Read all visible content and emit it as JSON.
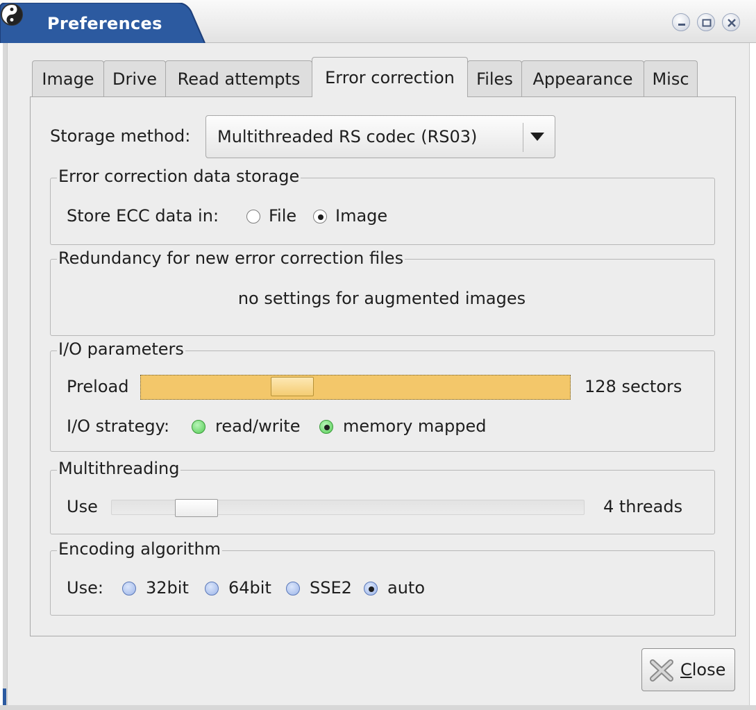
{
  "window": {
    "title": "Preferences",
    "title_bg": "#2c5aa0",
    "controls": [
      "minimize-icon",
      "maximize-icon",
      "close-icon"
    ]
  },
  "tabs": [
    {
      "label": "Image"
    },
    {
      "label": "Drive"
    },
    {
      "label": "Read attempts"
    },
    {
      "label": "Error correction",
      "active": true
    },
    {
      "label": "Files"
    },
    {
      "label": "Appearance"
    },
    {
      "label": "Misc"
    }
  ],
  "storage_method": {
    "label": "Storage method:",
    "value": "Multithreaded RS codec (RS03)"
  },
  "ecc_storage": {
    "title": "Error correction data storage",
    "label": "Store ECC data in:",
    "options": [
      {
        "label": "File",
        "selected": false
      },
      {
        "label": "Image",
        "selected": true
      }
    ]
  },
  "redundancy": {
    "title": "Redundancy for new error correction files",
    "message": "no settings for augmented images"
  },
  "io": {
    "title": "I/O parameters",
    "preload_label": "Preload",
    "preload_value": "128 sectors",
    "preload_fraction": 0.33,
    "strategy_label": "I/O strategy:",
    "strategy_options": [
      {
        "label": "read/write",
        "selected": false
      },
      {
        "label": "memory mapped",
        "selected": true
      }
    ],
    "accent": "#f3c76a"
  },
  "multithreading": {
    "title": "Multithreading",
    "use_label": "Use",
    "value": "4 threads",
    "fraction": 0.17
  },
  "encoding": {
    "title": "Encoding algorithm",
    "label": "Use:",
    "options": [
      {
        "label": "32bit",
        "selected": false
      },
      {
        "label": "64bit",
        "selected": false
      },
      {
        "label": "SSE2",
        "selected": false
      },
      {
        "label": "auto",
        "selected": true
      }
    ]
  },
  "close_button": {
    "mnemonic": "C",
    "rest": "lose"
  }
}
